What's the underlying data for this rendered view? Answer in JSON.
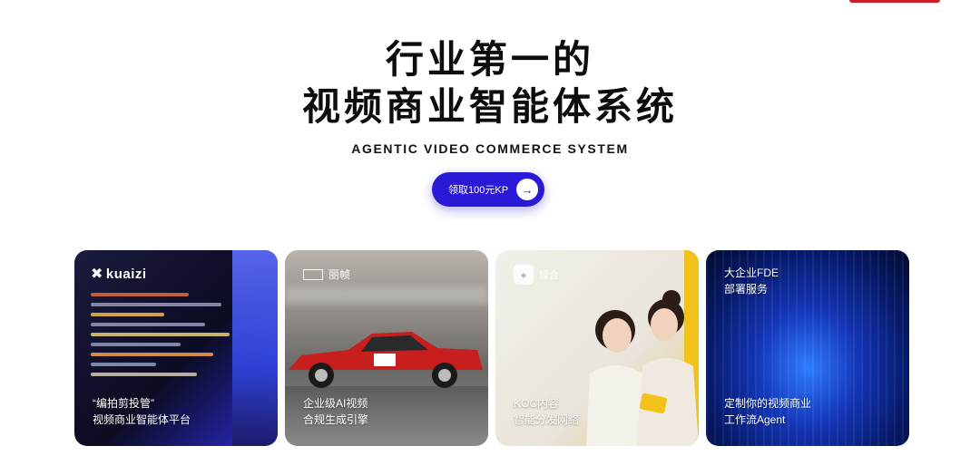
{
  "hero": {
    "title_line1": "行业第一的",
    "title_line2": "视频商业智能体系统",
    "subtitle": "AGENTIC VIDEO COMMERCE SYSTEM",
    "cta_label": "领取100元KP",
    "cta_icon": "arrow-right-icon"
  },
  "colors": {
    "accent": "#2a19d6",
    "top_bar": "#c8202a"
  },
  "cards": [
    {
      "logo_text": "kuaizi",
      "logo_icon": "kuaizi-logo-icon",
      "line1": "“编拍剪投管”",
      "line2": "视频商业智能体平台"
    },
    {
      "logo_text": "丽帧",
      "logo_icon": "lizhen-logo-icon",
      "line1": "企业级AI视频",
      "line2": "合规生成引擎"
    },
    {
      "logo_text": "绿合",
      "logo_icon": "lvhe-logo-icon",
      "line1": "KOC内容",
      "line2": "智能分发网络"
    },
    {
      "top_line1": "大企业FDE",
      "top_line2": "部署服务",
      "line1": "定制你的视频商业",
      "line2": "工作流Agent"
    }
  ]
}
